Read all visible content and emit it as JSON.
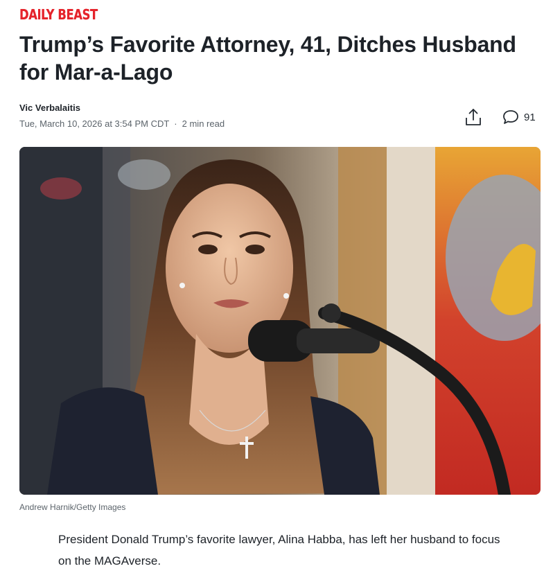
{
  "brand": {
    "logo_text": "DAILY BEAST",
    "accent_color": "#e5232b"
  },
  "article": {
    "headline": "Trump’s Favorite Attorney, 41, Ditches Husband for Mar-a-Lago",
    "author": "Vic Verbalaitis",
    "published": "Tue, March 10, 2026 at 3:54 PM CDT",
    "separator": "·",
    "read_time": "2 min read",
    "image_caption": "Andrew Harnik/Getty Images",
    "lede": "President Donald Trump’s favorite lawyer, Alina Habba, has left her husband to focus on the MAGAverse."
  },
  "actions": {
    "share_icon": "share-icon",
    "comment_icon": "comment-bubble-icon",
    "comment_count": "91"
  }
}
